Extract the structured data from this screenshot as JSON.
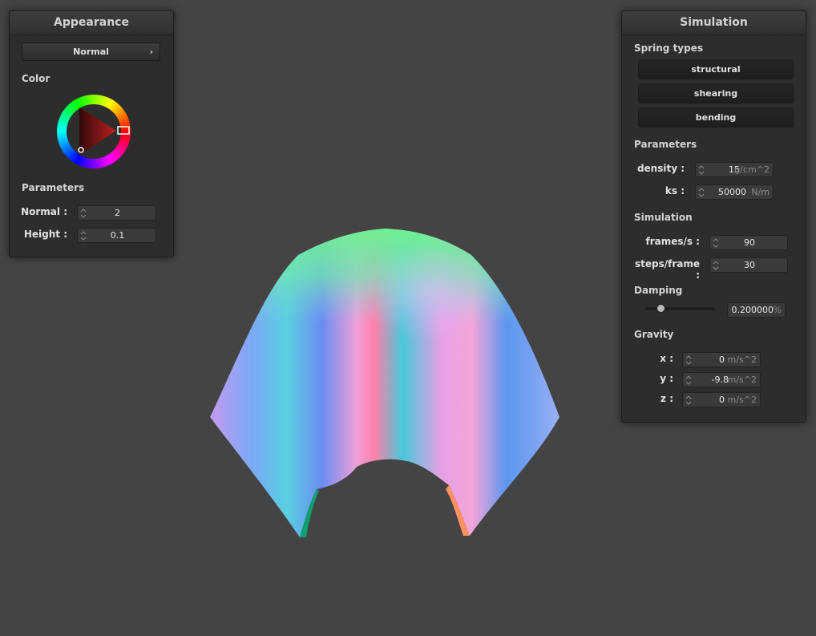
{
  "appearance": {
    "title": "Appearance",
    "shader_select": "Normal",
    "color_label": "Color",
    "parameters_label": "Parameters",
    "params": [
      {
        "label": "Normal :",
        "value": "2"
      },
      {
        "label": "Height :",
        "value": "0.1"
      }
    ]
  },
  "simulation": {
    "title": "Simulation",
    "spring_types_label": "Spring types",
    "spring_buttons": [
      "structural",
      "shearing",
      "bending"
    ],
    "parameters_label": "Parameters",
    "density": {
      "label": "density :",
      "value": "15",
      "unit": "g/cm^2"
    },
    "ks": {
      "label": "ks :",
      "value": "50000",
      "unit": "N/m"
    },
    "simulation_label": "Simulation",
    "frames": {
      "label": "frames/s :",
      "value": "90"
    },
    "steps": {
      "label": "steps/frame :",
      "value": "30"
    },
    "damping_label": "Damping",
    "damping": {
      "value": "0.200000",
      "unit": "%",
      "slider_fraction": 0.2
    },
    "gravity_label": "Gravity",
    "gravity": [
      {
        "label": "x :",
        "value": "0",
        "unit": "m/s^2"
      },
      {
        "label": "y :",
        "value": "-9.8",
        "unit": "m/s^2"
      },
      {
        "label": "z :",
        "value": "0",
        "unit": "m/s^2"
      }
    ]
  },
  "colors": {
    "background": "#444444",
    "panel": "#2d2d2d",
    "selected_color": "#e02020"
  }
}
